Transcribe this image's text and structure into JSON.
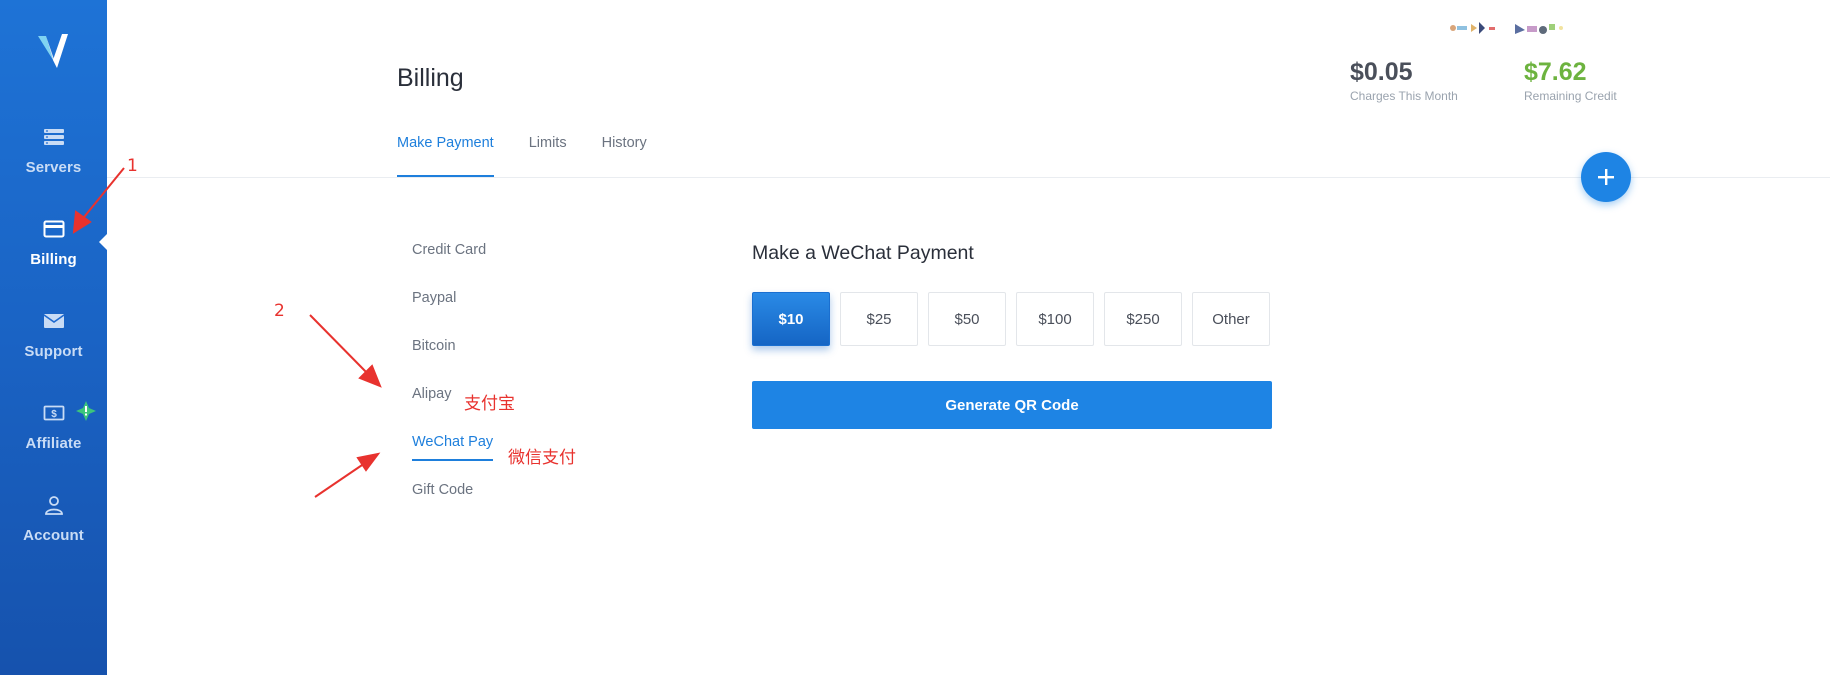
{
  "sidebar": {
    "logo": "vultr-logo",
    "items": [
      {
        "label": "Servers",
        "icon": "server-icon"
      },
      {
        "label": "Billing",
        "icon": "credit-card-icon"
      },
      {
        "label": "Support",
        "icon": "envelope-icon"
      },
      {
        "label": "Affiliate",
        "icon": "dollar-icon"
      },
      {
        "label": "Account",
        "icon": "user-icon"
      }
    ],
    "active": "Billing"
  },
  "header": {
    "title": "Billing",
    "charges": {
      "value": "$0.05",
      "label": "Charges This Month"
    },
    "credit": {
      "value": "$7.62",
      "label": "Remaining Credit"
    }
  },
  "tabs": [
    {
      "label": "Make Payment",
      "active": true
    },
    {
      "label": "Limits",
      "active": false
    },
    {
      "label": "History",
      "active": false
    }
  ],
  "payment_methods": [
    {
      "label": "Credit Card",
      "active": false
    },
    {
      "label": "Paypal",
      "active": false
    },
    {
      "label": "Bitcoin",
      "active": false
    },
    {
      "label": "Alipay",
      "active": false
    },
    {
      "label": "WeChat Pay",
      "active": true
    },
    {
      "label": "Gift Code",
      "active": false
    }
  ],
  "payment": {
    "title": "Make a WeChat Payment",
    "amounts": [
      "$10",
      "$25",
      "$50",
      "$100",
      "$250",
      "Other"
    ],
    "selected_amount": "$10",
    "generate_label": "Generate QR Code"
  },
  "annotations": {
    "step1": "1",
    "step2": "2",
    "alipay_cn": "支付宝",
    "wechat_cn": "微信支付"
  },
  "colors": {
    "brand": "#1e73d6",
    "accent": "#1e84e4",
    "credit_green": "#6db33f",
    "annotation_red": "#e8322e"
  }
}
